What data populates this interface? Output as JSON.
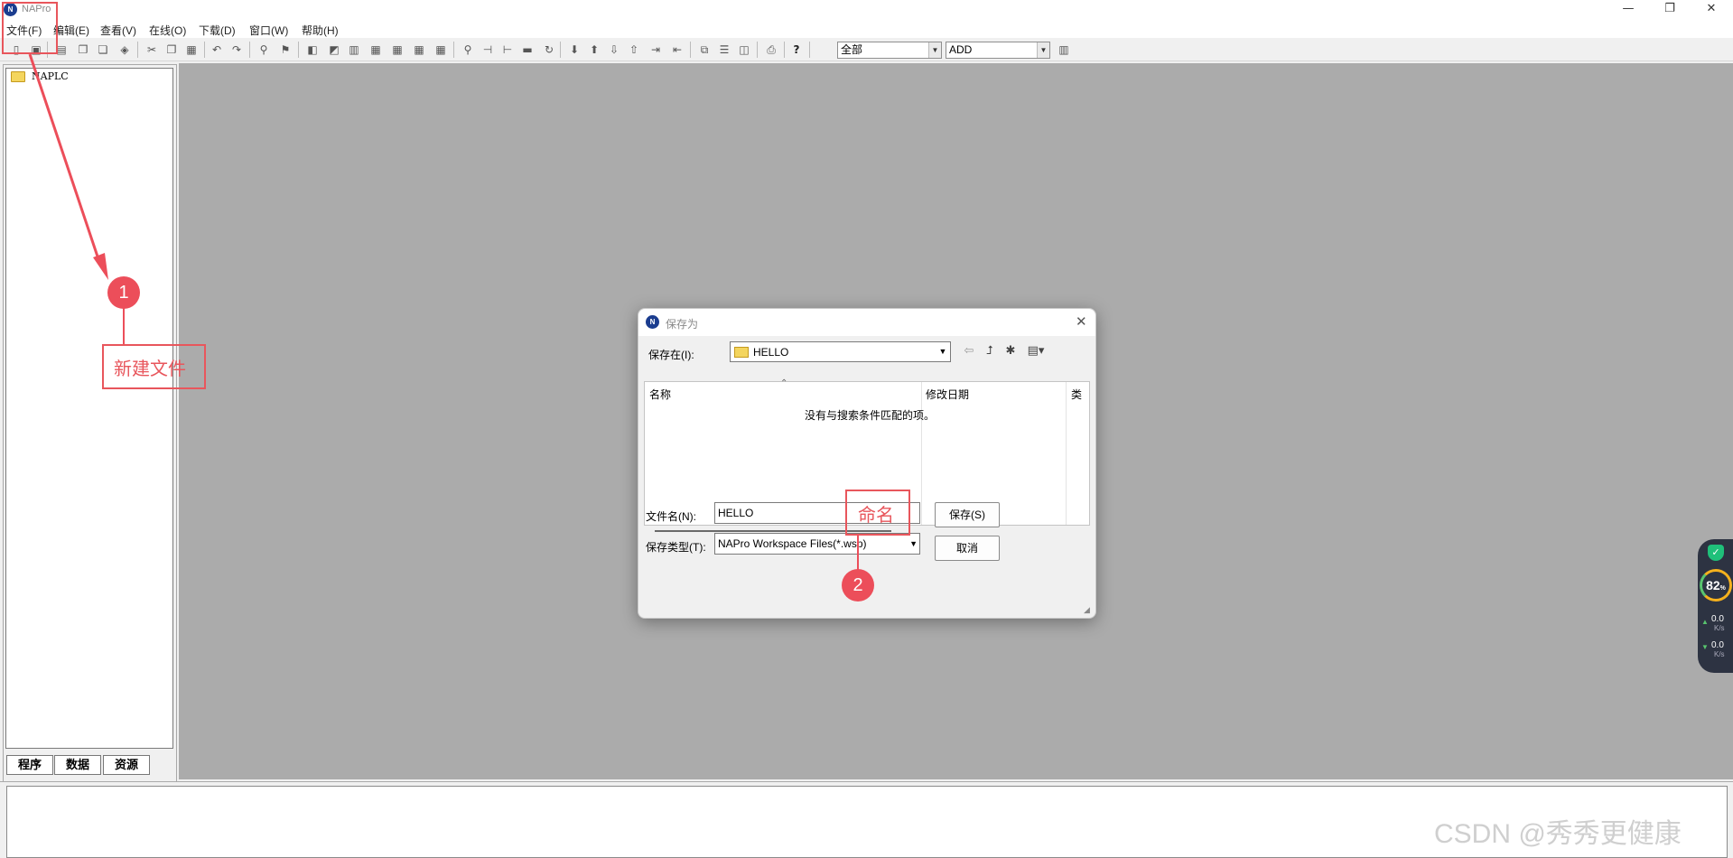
{
  "app": {
    "title": "NAPro",
    "logo": "N"
  },
  "window_controls": {
    "minimize": "—",
    "maximize": "❐",
    "close": "✕"
  },
  "menu": [
    "文件(F)",
    "编辑(E)",
    "查看(V)",
    "在线(O)",
    "下载(D)",
    "窗口(W)",
    "帮助(H)"
  ],
  "toolbar": {
    "filter_combo": "全部",
    "instruction_combo": "ADD"
  },
  "tree": {
    "root": "NAPLC"
  },
  "panel_tabs": [
    "程序",
    "数据",
    "资源"
  ],
  "dialog": {
    "title": "保存为",
    "logo": "N",
    "save_in_label": "保存在(I):",
    "save_in_value": "HELLO",
    "columns": [
      "名称",
      "修改日期",
      "类"
    ],
    "empty_message": "没有与搜索条件匹配的项。",
    "filename_label": "文件名(N):",
    "filename_value": "HELLO",
    "filetype_label": "保存类型(T):",
    "filetype_value": "NAPro Workspace Files(*.wsp)",
    "save_button": "保存(S)",
    "cancel_button": "取消"
  },
  "annotations": [
    {
      "badge": "1",
      "text": "新建文件"
    },
    {
      "badge": "2",
      "text": "命名"
    }
  ],
  "net_widget": {
    "cpu": "82",
    "cpu_unit": "%",
    "upload": "0.0",
    "download": "0.0",
    "unit": "K/s"
  },
  "watermark": "CSDN @秀秀更健康",
  "colors": {
    "annotation": "#e8565c",
    "mdi_background": "#ababab"
  }
}
